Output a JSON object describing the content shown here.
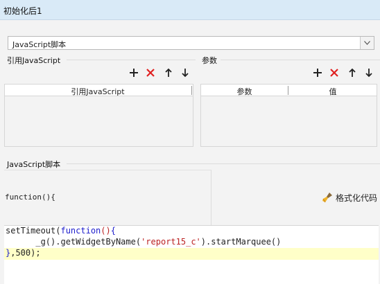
{
  "window": {
    "title": "初始化后1"
  },
  "script_type": {
    "selected": "JavaScript脚本"
  },
  "refs": {
    "label": "引用JavaScript",
    "column": "引用JavaScript"
  },
  "params": {
    "label": "参数",
    "columns": [
      "参数",
      "值"
    ]
  },
  "script": {
    "label": "JavaScript脚本",
    "header": "function(){",
    "format_label": "格式化代码",
    "lines": [
      "setTimeout(function(){",
      "      _g().getWidgetByName('report15_c').startMarquee()",
      "},500);"
    ],
    "highlighted_line": 3
  },
  "icons": {
    "add": "plus-icon",
    "remove": "red-x-icon",
    "up": "arrow-up-icon",
    "down": "arrow-down-icon",
    "format": "broom-icon"
  },
  "colors": {
    "titlebar": "#d9eaf7",
    "remove_red": "#e02020",
    "keyword": "#1c1ccc",
    "string": "#b22222",
    "highlight": "#ffffc8"
  }
}
